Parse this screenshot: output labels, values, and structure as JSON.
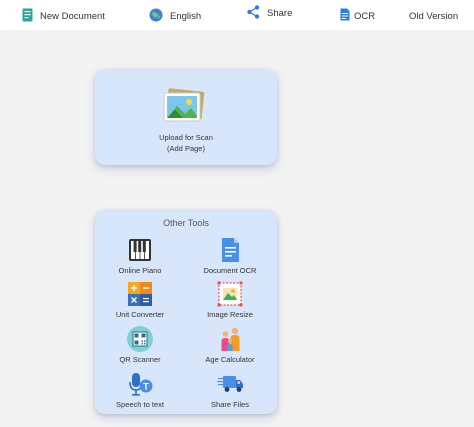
{
  "topbar": {
    "new_document": "New Document",
    "language": "English",
    "share": "Share",
    "ocr": "OCR",
    "old_version": "Old Version"
  },
  "upload": {
    "line1": "Upload for Scan",
    "line2": "(Add Page)"
  },
  "tools": {
    "title": "Other Tools",
    "items": [
      {
        "label": "Online Piano",
        "icon": "piano-icon"
      },
      {
        "label": "Document OCR",
        "icon": "document-ocr-icon"
      },
      {
        "label": "Unit Converter",
        "icon": "calculator-icon"
      },
      {
        "label": "Image Resize",
        "icon": "image-resize-icon"
      },
      {
        "label": "QR Scanner",
        "icon": "qr-code-icon"
      },
      {
        "label": "Age Calculator",
        "icon": "family-icon"
      },
      {
        "label": "Speech to text",
        "icon": "microphone-icon"
      },
      {
        "label": "Share Files",
        "icon": "delivery-truck-icon"
      }
    ]
  },
  "colors": {
    "card_background": "#d8e6fb",
    "page_background": "#f3f3f3",
    "accent_blue": "#2f7de1"
  }
}
